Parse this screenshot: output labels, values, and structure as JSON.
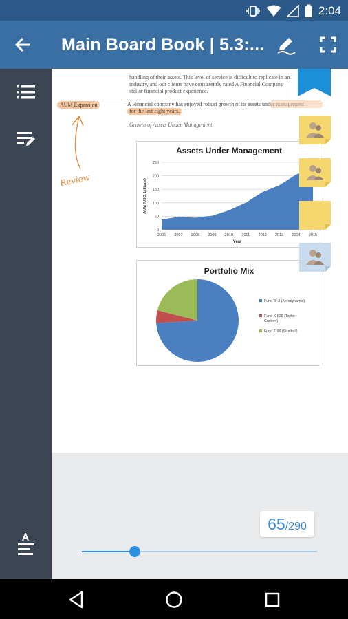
{
  "status_bar": {
    "time": "2:04",
    "icons": [
      "vibrate-icon",
      "wifi-icon",
      "signal-icon",
      "battery-icon"
    ]
  },
  "app_bar": {
    "title": "Main Board Book | 5.3:...",
    "back_icon": "arrow-back-icon",
    "annotate_icon": "pen-icon",
    "fullscreen_icon": "fullscreen-icon"
  },
  "sidebar": {
    "items": [
      {
        "icon": "list-icon"
      },
      {
        "icon": "edit-list-icon"
      }
    ],
    "bottom_icon": "text-size-icon"
  },
  "document": {
    "paragraph_top_1": "handling of their assets. This level of service is difficult to replicate in an",
    "paragraph_top_2": "industry, and our clients have consistently rated A Financial Company",
    "paragraph_top_3": "stellar financial product experience.",
    "margin_label": "AUM Expansion",
    "paragraph_main_1": "A Financial company has enjoyed robust growth of its assets under management",
    "paragraph_main_2": "for the last eight years.",
    "caption": "Growth of Assets Under Management",
    "handwritten_note": "Review"
  },
  "chart_data": [
    {
      "type": "area",
      "title": "Assets Under Management",
      "xlabel": "Year",
      "ylabel": "AUM (USD, billions)",
      "x": [
        "2006",
        "2007",
        "2008",
        "2009",
        "2010",
        "2011",
        "2012",
        "2013",
        "2014",
        "2015"
      ],
      "values": [
        38,
        48,
        45,
        52,
        72,
        100,
        140,
        165,
        205,
        225
      ],
      "yticks": [
        "0",
        "50",
        "100",
        "150",
        "200",
        "250"
      ],
      "ylim": [
        0,
        250
      ],
      "color": "#4a7fc1",
      "grid": true
    },
    {
      "type": "pie",
      "title": "Portfolio Mix",
      "slices": [
        {
          "label": "Fund W-3 (Aerodynamic)",
          "value": 74,
          "color": "#4a7fc1"
        },
        {
          "label": "Fund X-825 (Taylor Custom)",
          "value": 5,
          "color": "#c0504d"
        },
        {
          "label": "Fund Z-99 (Streihull)",
          "value": 21,
          "color": "#9bbb59"
        }
      ],
      "legend": "right"
    }
  ],
  "notes": [
    {
      "color": "#f5d76e",
      "icon": "user-note-icon"
    },
    {
      "color": "#f5d76e",
      "icon": "user-note-icon"
    },
    {
      "color": "#f5d76e",
      "icon": "note-icon"
    },
    {
      "color": "#c9dbef",
      "icon": "user-note-icon"
    }
  ],
  "bookmark_color": "#1d8ed8",
  "pagination": {
    "current": "65",
    "total": "/290",
    "progress": 0.224
  },
  "navigation": {
    "back": "back-triangle-icon",
    "home": "home-circle-icon",
    "recents": "recents-square-icon"
  }
}
